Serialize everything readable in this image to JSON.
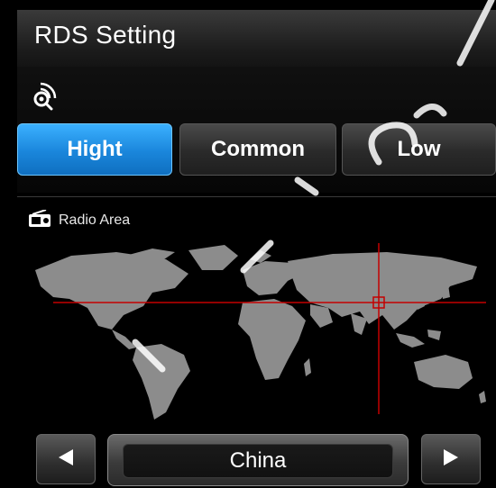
{
  "header": {
    "title": "RDS Setting"
  },
  "sensitivity": {
    "icon": "signal-search-icon",
    "options": [
      {
        "label": "Hight",
        "active": true
      },
      {
        "label": "Common",
        "active": false
      },
      {
        "label": "Low",
        "active": false
      }
    ]
  },
  "radio_area": {
    "icon": "radio-icon",
    "label": "Radio Area",
    "selected_region": "China",
    "prev_icon": "arrow-left-icon",
    "next_icon": "arrow-right-icon"
  },
  "colors": {
    "accent": "#1a86db",
    "crosshair": "#c40000",
    "map_land": "#8c8c8c"
  }
}
